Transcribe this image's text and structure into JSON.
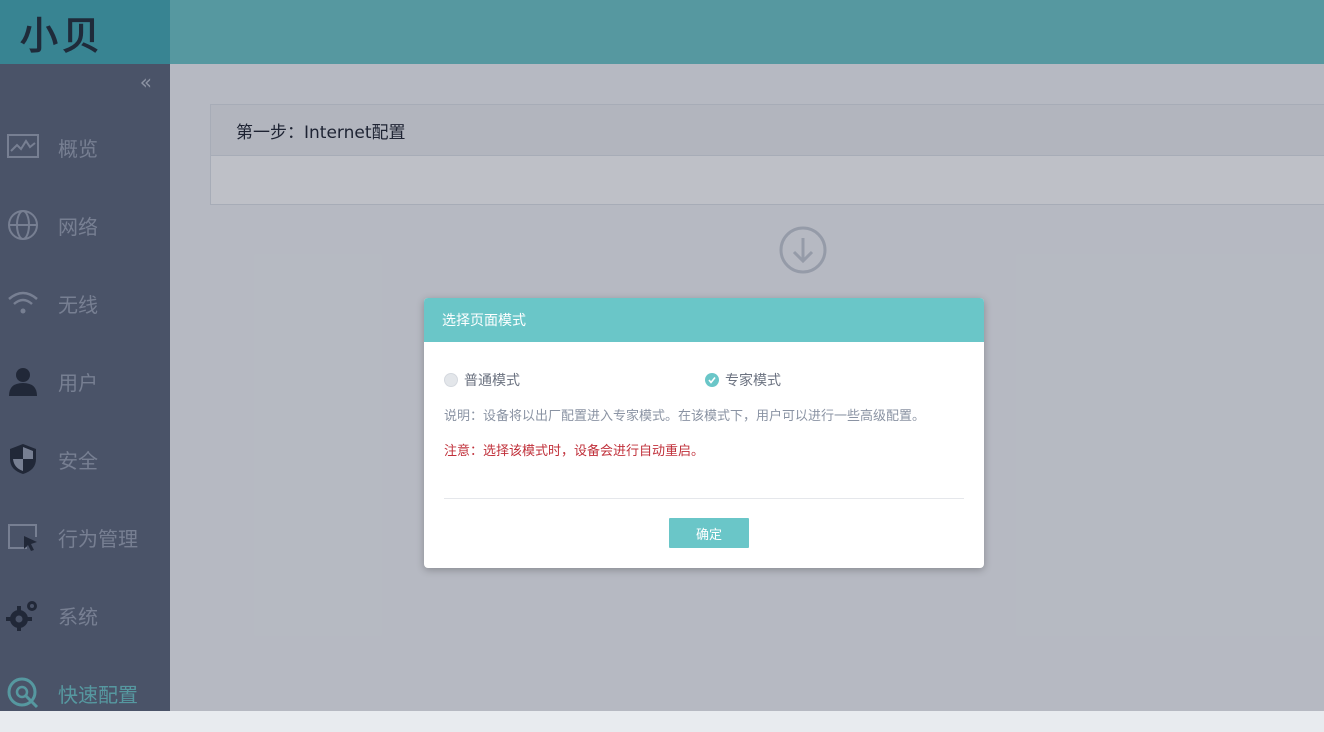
{
  "brand": {
    "logo_text": "小贝"
  },
  "sidebar": {
    "collapse_glyph": "«",
    "items": [
      {
        "label": "概览",
        "icon": "chart-icon"
      },
      {
        "label": "网络",
        "icon": "globe-icon"
      },
      {
        "label": "无线",
        "icon": "wifi-icon"
      },
      {
        "label": "用户",
        "icon": "user-icon"
      },
      {
        "label": "安全",
        "icon": "shield-icon"
      },
      {
        "label": "行为管理",
        "icon": "behavior-icon"
      },
      {
        "label": "系统",
        "icon": "gear-icon"
      },
      {
        "label": "快速配置",
        "icon": "quick-config-icon",
        "active": true
      }
    ]
  },
  "main": {
    "step_title": "第一步：Internet配置"
  },
  "modal": {
    "title": "选择页面模式",
    "mode_normal": "普通模式",
    "mode_expert": "专家模式",
    "selected_mode": "专家模式",
    "description": "说明：设备将以出厂配置进入专家模式。在该模式下，用户可以进行一些高级配置。",
    "note": "注意：选择该模式时，设备会进行自动重启。",
    "confirm_label": "确定"
  },
  "colors": {
    "accent": "#6ac6c8",
    "sidebar_bg": "#5a6377",
    "warning": "#c0303a"
  }
}
